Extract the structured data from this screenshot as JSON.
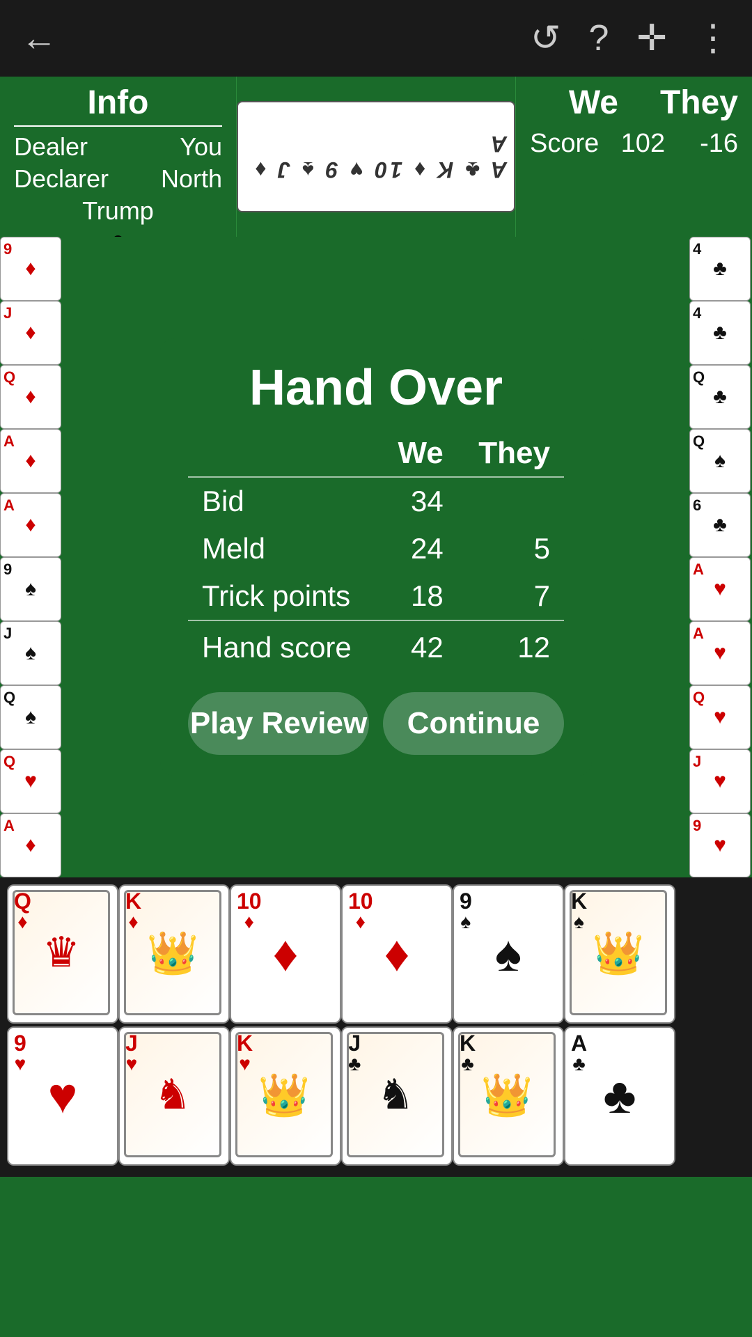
{
  "topBar": {
    "backIcon": "←",
    "undoIcon": "↺",
    "helpIcon": "?",
    "addIcon": "✛",
    "menuIcon": "⋮"
  },
  "infoSection": {
    "title": "Info",
    "dealerLabel": "Dealer",
    "dealerValue": "You",
    "declarerLabel": "Declarer",
    "declarerValue": "North",
    "trumpLabel": "Trump",
    "trumpSuit": "♣"
  },
  "scoreSection": {
    "weLabel": "We",
    "theyLabel": "They",
    "scoreLabel": "Score",
    "weScore": "102",
    "theyScore": "-16"
  },
  "handOver": {
    "title": "Hand Over",
    "weLabel": "We",
    "theyLabel": "They",
    "rows": [
      {
        "label": "Bid",
        "we": "34",
        "they": ""
      },
      {
        "label": "Meld",
        "we": "24",
        "they": "5"
      },
      {
        "label": "Trick points",
        "we": "18",
        "they": "7"
      },
      {
        "label": "Hand score",
        "we": "42",
        "they": "12"
      }
    ],
    "playReviewBtn": "Play Review",
    "continueBtn": "Continue"
  },
  "leftCards": [
    {
      "rank": "9",
      "suit": "♦",
      "color": "red"
    },
    {
      "rank": "J",
      "suit": "♦",
      "color": "red"
    },
    {
      "rank": "Q",
      "suit": "♦",
      "color": "red"
    },
    {
      "rank": "A",
      "suit": "♦",
      "color": "red"
    },
    {
      "rank": "A",
      "suit": "♦",
      "color": "red"
    },
    {
      "rank": "9",
      "suit": "♠",
      "color": "black"
    },
    {
      "rank": "J",
      "suit": "♠",
      "color": "black"
    },
    {
      "rank": "Q",
      "suit": "♠",
      "color": "black"
    },
    {
      "rank": "Q",
      "suit": "♥",
      "color": "red"
    },
    {
      "rank": "A",
      "suit": "♦",
      "color": "red"
    }
  ],
  "rightCards": [
    {
      "rank": "4",
      "suit": "♣",
      "color": "black"
    },
    {
      "rank": "4",
      "suit": "♣",
      "color": "black"
    },
    {
      "rank": "Q",
      "suit": "♣",
      "color": "black"
    },
    {
      "rank": "Q",
      "suit": "♠",
      "color": "black"
    },
    {
      "rank": "6",
      "suit": "♣",
      "color": "black"
    },
    {
      "rank": "A",
      "suit": "♥",
      "color": "red"
    },
    {
      "rank": "A",
      "suit": "♥",
      "color": "red"
    },
    {
      "rank": "Q",
      "suit": "♥",
      "color": "red"
    },
    {
      "rank": "J",
      "suit": "♥",
      "color": "red"
    },
    {
      "rank": "9",
      "suit": "♥",
      "color": "red"
    }
  ],
  "bottomCards": {
    "row1": [
      {
        "rank": "Q",
        "suit": "♦",
        "color": "red",
        "face": true
      },
      {
        "rank": "K",
        "suit": "♦",
        "color": "red",
        "face": true
      },
      {
        "rank": "10",
        "suit": "♦",
        "color": "red",
        "face": false
      },
      {
        "rank": "10",
        "suit": "♦",
        "color": "red",
        "face": false
      },
      {
        "rank": "9",
        "suit": "♠",
        "color": "black",
        "face": false
      },
      {
        "rank": "K",
        "suit": "♠",
        "color": "black",
        "face": true
      }
    ],
    "row2": [
      {
        "rank": "9",
        "suit": "♥",
        "color": "red",
        "face": false
      },
      {
        "rank": "J",
        "suit": "♥",
        "color": "red",
        "face": true
      },
      {
        "rank": "K",
        "suit": "♥",
        "color": "red",
        "face": true
      },
      {
        "rank": "J",
        "suit": "♣",
        "color": "black",
        "face": true
      },
      {
        "rank": "K",
        "suit": "♣",
        "color": "black",
        "face": true
      },
      {
        "rank": "A",
        "suit": "♣",
        "color": "black",
        "face": false
      }
    ]
  }
}
